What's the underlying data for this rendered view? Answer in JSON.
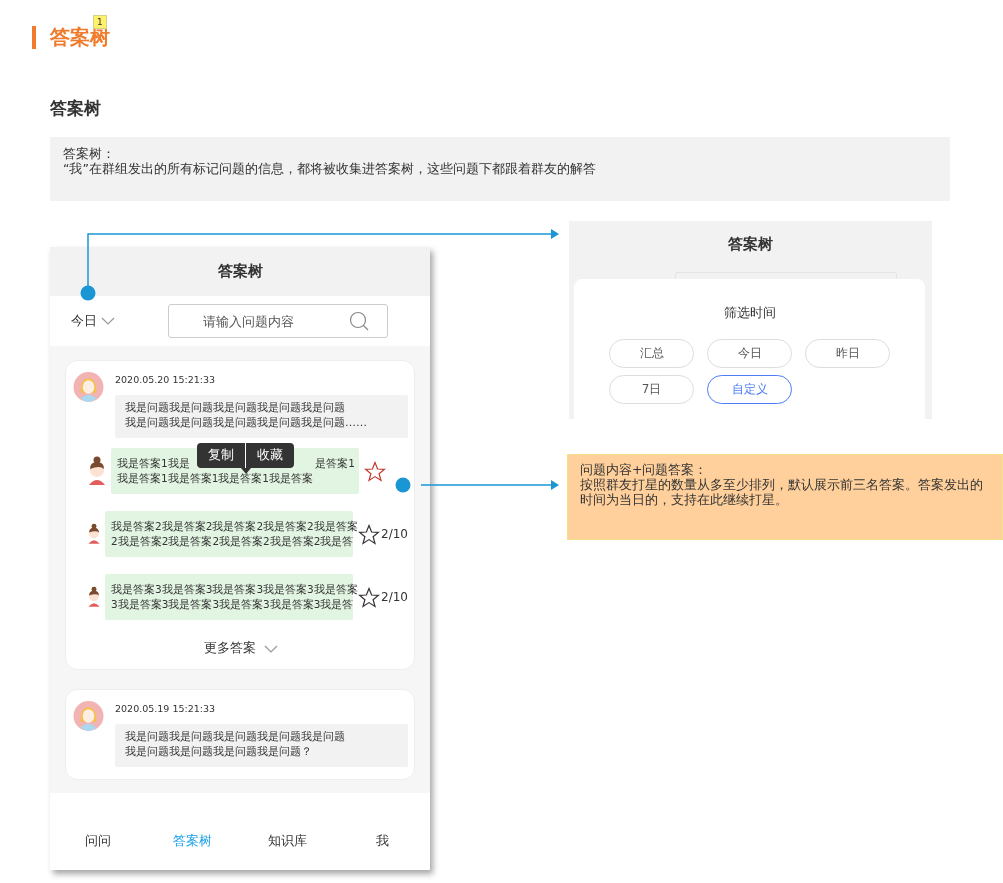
{
  "header": {
    "title": "答案树",
    "badge": "1"
  },
  "section_title": "答案树",
  "note": {
    "lines": [
      "答案树：",
      "“我”在群组发出的所有标记问题的信息，都将被收集进答案树，这些问题下都跟着群友的解答"
    ]
  },
  "phone": {
    "title": "答案树",
    "filter": "今日",
    "search": {
      "placeholder": "请输入问题内容"
    },
    "questions": [
      {
        "time": "2020.05.20 15:21:33",
        "lines": [
          "我是问题我是问题我是问题我是问题我是问题",
          "我是问题我是问题我是问题我是问题我是问题……"
        ],
        "more": "更多答案",
        "answers": [
          {
            "lines": [
              [
                "我是答案1我是",
                "是答案1"
              ],
              [
                "我是答案1我是答案1我是答案1我是答案"
              ]
            ],
            "marked": true,
            "menu": [
              "复制",
              "收藏"
            ]
          },
          {
            "lines": [
              [
                "我是答案2我是答案2我是答案2我是答案2我是答案"
              ],
              [
                "2我是答案2我是答案2我是答案2我是答案2我是答"
              ]
            ],
            "marked": false,
            "count": "2/10"
          },
          {
            "lines": [
              [
                "我是答案3我是答案3我是答案3我是答案3我是答案"
              ],
              [
                "3我是答案3我是答案3我是答案3我是答案3我是答"
              ]
            ],
            "marked": false,
            "count": "2/10"
          }
        ]
      },
      {
        "time": "2020.05.19 15:21:33",
        "lines": [
          "我是问题我是问题我是问题我是问题我是问题",
          "我是问题我是问题我是问题我是问题？"
        ]
      }
    ],
    "nav": [
      {
        "label": "问问",
        "selected": false
      },
      {
        "label": "答案树",
        "selected": true
      },
      {
        "label": "知识库",
        "selected": false
      },
      {
        "label": "我",
        "selected": false
      }
    ]
  },
  "filter_panel": {
    "title": "答案树",
    "sheet_title": "筛选时间",
    "options": [
      {
        "label": "汇总",
        "selected": false
      },
      {
        "label": "今日",
        "selected": false
      },
      {
        "label": "昨日",
        "selected": false
      },
      {
        "label": "7日",
        "selected": false
      },
      {
        "label": "自定义",
        "selected": true
      }
    ]
  },
  "annotation": {
    "lines": [
      "问题内容+问题答案：",
      "按照群友打星的数量从多至少排列，默认展示前三名答案。答案发出的时间为当日的，支持在此继续打星。"
    ]
  }
}
